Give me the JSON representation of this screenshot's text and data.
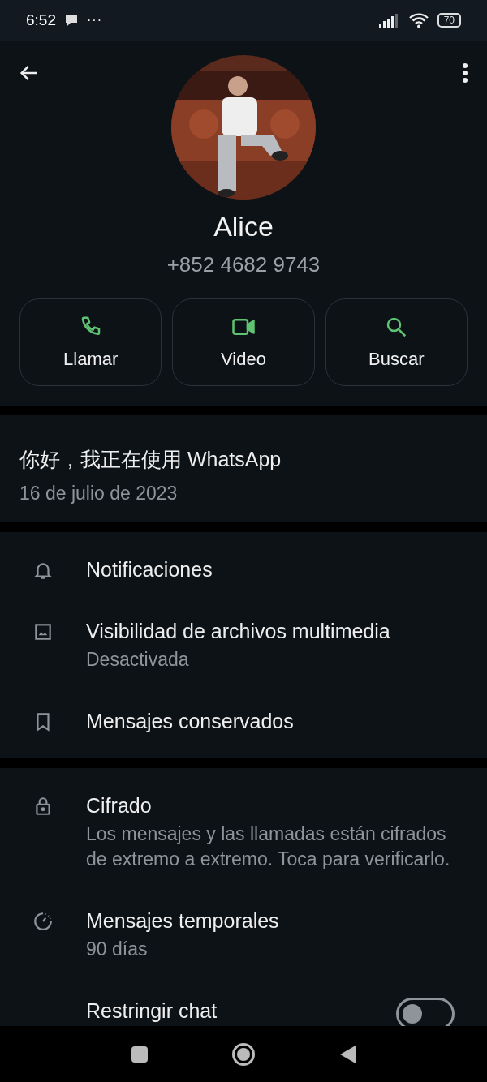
{
  "status_bar": {
    "time": "6:52",
    "notification_more": "···",
    "battery": "70"
  },
  "profile": {
    "name": "Alice",
    "phone": "+852 4682 9743"
  },
  "actions": [
    {
      "kind": "call",
      "label": "Llamar"
    },
    {
      "kind": "video",
      "label": "Video"
    },
    {
      "kind": "search",
      "label": "Buscar"
    }
  ],
  "about": {
    "text": "你好，我正在使用 WhatsApp",
    "date": "16 de julio de 2023"
  },
  "sections": [
    [
      {
        "kind": "bell",
        "title": "Notificaciones"
      },
      {
        "kind": "media",
        "title": "Visibilidad de archivos multimedia",
        "subtitle": "Desactivada"
      },
      {
        "kind": "bookmark",
        "title": "Mensajes conservados"
      }
    ],
    [
      {
        "kind": "lock",
        "title": "Cifrado",
        "subtitle": "Los mensajes y las llamadas están cifrados de extremo a extremo. Toca para verificarlo."
      },
      {
        "kind": "timer",
        "title": "Mensajes temporales",
        "subtitle": "90 días"
      },
      {
        "kind": "toggle",
        "title": "Restringir chat",
        "on": false
      }
    ]
  ]
}
